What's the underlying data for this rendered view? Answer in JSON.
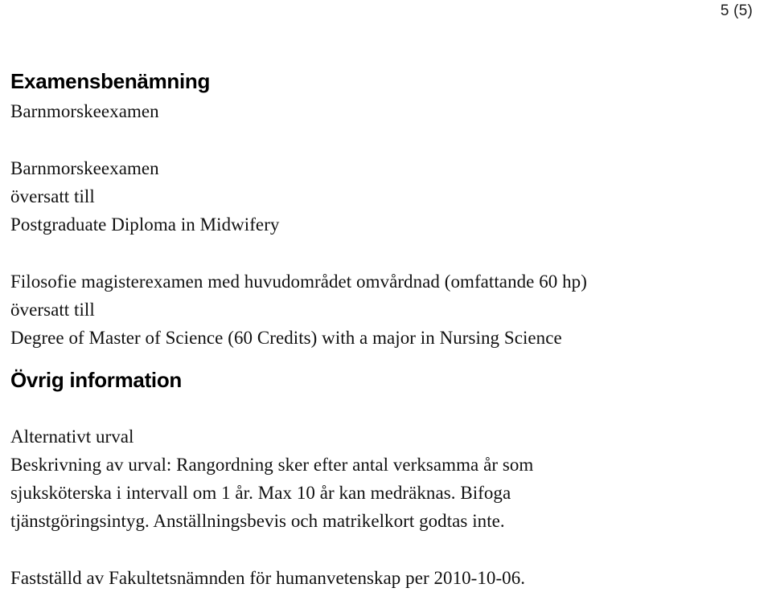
{
  "document": {
    "page_indicator": "5 (5)"
  },
  "sections": [
    {
      "heading": "Examensbenämning",
      "paragraphs": [
        {
          "lines": [
            "Barnmorskeexamen"
          ]
        },
        {
          "lines": [
            "Barnmorskeexamen",
            "översatt till",
            "Postgraduate Diploma in Midwifery"
          ]
        },
        {
          "lines": [
            "Filosofie magisterexamen med huvudområdet omvårdnad (omfattande 60 hp)",
            "översatt till",
            "Degree of Master of Science (60 Credits) with a major in Nursing Science"
          ]
        }
      ]
    },
    {
      "heading": "Övrig information",
      "paragraphs": [
        {
          "lines": [
            "Alternativt urval"
          ]
        },
        {
          "lines": [
            "Beskrivning av urval: Rangordning sker efter antal verksamma år som",
            "sjuksköterska i intervall om 1 år. Max 10 år kan medräknas. Bifoga",
            "tjänstgöringsintyg. Anställningsbevis och matrikelkort godtas inte."
          ]
        },
        {
          "lines": [
            "Fastställd av Fakultetsnämnden för humanvetenskap per 2010-10-06."
          ]
        }
      ]
    }
  ],
  "text": {
    "page_indicator": "5 (5)",
    "heading_examensbenamning": "Examensbenämning",
    "heading_ovrig_information": "Övrig information",
    "l1": "Barnmorskeexamen",
    "l2": "Barnmorskeexamen",
    "l3": "översatt till",
    "l4": "Postgraduate Diploma in Midwifery",
    "l5": "Filosofie magisterexamen med huvudområdet omvårdnad (omfattande 60 hp)",
    "l6": "översatt till",
    "l7": "Degree of Master of Science (60 Credits) with a major in Nursing Science",
    "l8": "Alternativt urval",
    "l9": "Beskrivning av urval: Rangordning sker efter antal verksamma år som",
    "l10": "sjuksköterska i intervall om 1 år. Max 10 år kan medräknas. Bifoga",
    "l11": "tjänstgöringsintyg. Anställningsbevis och matrikelkort godtas inte.",
    "l12": "Fastställd av Fakultetsnämnden för humanvetenskap per 2010-10-06."
  },
  "colors": {
    "page_background": "#ffffff",
    "text": "#111111",
    "heading": "#000000"
  }
}
